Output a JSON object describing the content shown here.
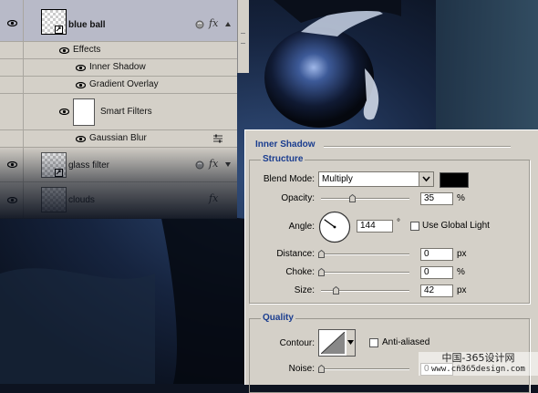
{
  "layers_panel": {
    "rows": [
      {
        "label": "blue ball",
        "kind": "layer",
        "selected": true
      },
      {
        "label": "Effects",
        "kind": "effects-header"
      },
      {
        "label": "Inner Shadow",
        "kind": "effect"
      },
      {
        "label": "Gradient Overlay",
        "kind": "effect"
      },
      {
        "label": "Smart Filters",
        "kind": "smart-filters"
      },
      {
        "label": "Gaussian Blur",
        "kind": "filter"
      },
      {
        "label": "glass filter",
        "kind": "layer"
      },
      {
        "label": "clouds",
        "kind": "layer"
      }
    ],
    "fx_label": "fx"
  },
  "layer_style_dialog": {
    "section_title": "Inner Shadow",
    "structure": {
      "title": "Structure",
      "blend_mode": {
        "label": "Blend Mode:",
        "value": "Multiply",
        "swatch_color": "#000000"
      },
      "opacity": {
        "label": "Opacity:",
        "value": "35",
        "unit": "%",
        "level": 0.35
      },
      "angle": {
        "label": "Angle:",
        "value": "144",
        "unit": "°",
        "use_global_light_label": "Use Global Light",
        "use_global_light": false
      },
      "distance": {
        "label": "Distance:",
        "value": "0",
        "unit": "px",
        "level": 0.0
      },
      "choke": {
        "label": "Choke:",
        "value": "0",
        "unit": "%",
        "level": 0.0
      },
      "size": {
        "label": "Size:",
        "value": "42",
        "unit": "px",
        "level": 0.17
      }
    },
    "quality": {
      "title": "Quality",
      "contour": {
        "label": "Contour:"
      },
      "anti_aliased": {
        "label": "Anti-aliased",
        "checked": false
      },
      "noise": {
        "label": "Noise:",
        "value": "0",
        "unit": "%",
        "level": 0.0
      }
    }
  },
  "watermark": {
    "line1": "中国-365设计网",
    "line2": "www.cn365design.com"
  },
  "colors": {
    "panel_bg": "#d4d0c8",
    "selected_row": "#b8bac8",
    "group_title": "#1a3d8f",
    "photo_dark": "#0d1320"
  }
}
